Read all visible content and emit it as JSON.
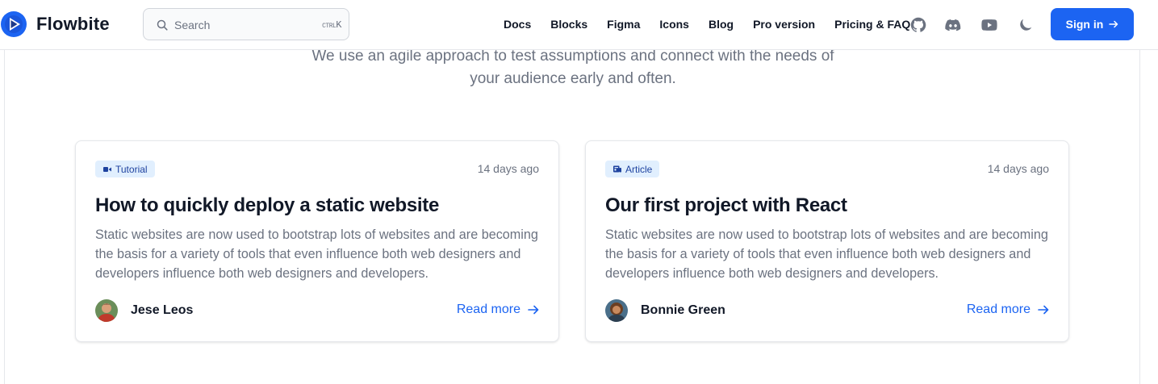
{
  "header": {
    "brand": "Flowbite",
    "search": {
      "placeholder": "Search",
      "shortcut_ctrl": "CTRL",
      "shortcut_key": "K"
    },
    "nav": [
      "Docs",
      "Blocks",
      "Figma",
      "Icons",
      "Blog",
      "Pro version",
      "Pricing & FAQ"
    ],
    "icons": [
      "github-icon",
      "discord-icon",
      "youtube-icon",
      "moon-icon"
    ],
    "signin_label": "Sign in",
    "accent_color": "#1c64f2"
  },
  "section": {
    "subtitle": "We use an agile approach to test assumptions and connect with the needs of your audience early and often."
  },
  "posts": [
    {
      "badge": "Tutorial",
      "badge_icon": "video-icon",
      "date": "14 days ago",
      "title": "How to quickly deploy a static website",
      "description": "Static websites are now used to bootstrap lots of websites and are becoming the basis for a variety of tools that even influence both web designers and developers influence both web designers and developers.",
      "author": "Jese Leos",
      "read_more": "Read more"
    },
    {
      "badge": "Article",
      "badge_icon": "newspaper-icon",
      "date": "14 days ago",
      "title": "Our first project with React",
      "description": "Static websites are now used to bootstrap lots of websites and are becoming the basis for a variety of tools that even influence both web designers and developers influence both web designers and developers.",
      "author": "Bonnie Green",
      "read_more": "Read more"
    }
  ]
}
